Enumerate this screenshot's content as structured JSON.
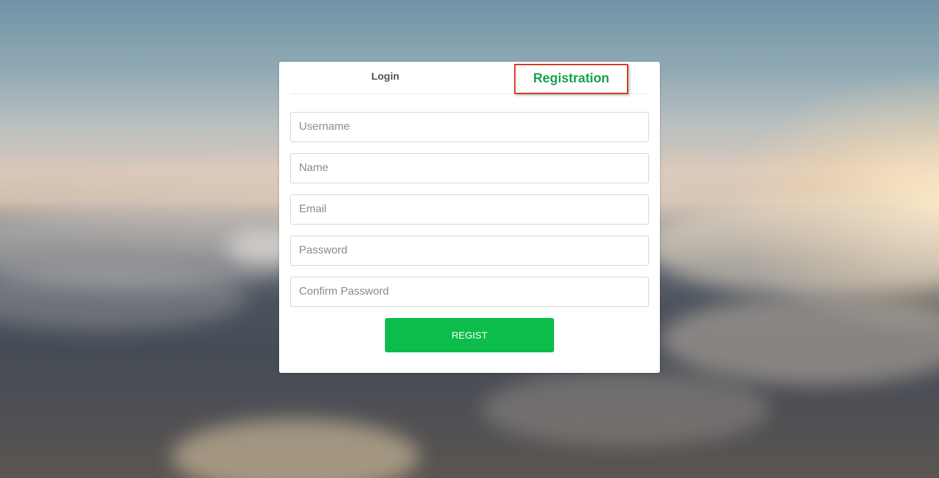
{
  "tabs": {
    "login_label": "Login",
    "registration_label": "Registration"
  },
  "form": {
    "username_placeholder": "Username",
    "name_placeholder": "Name",
    "email_placeholder": "Email",
    "password_placeholder": "Password",
    "confirm_password_placeholder": "Confirm Password",
    "submit_label": "REGIST"
  },
  "colors": {
    "accent_green": "#0cbd4b",
    "active_tab_text": "#18a04f",
    "highlight_border": "#d9351f"
  }
}
